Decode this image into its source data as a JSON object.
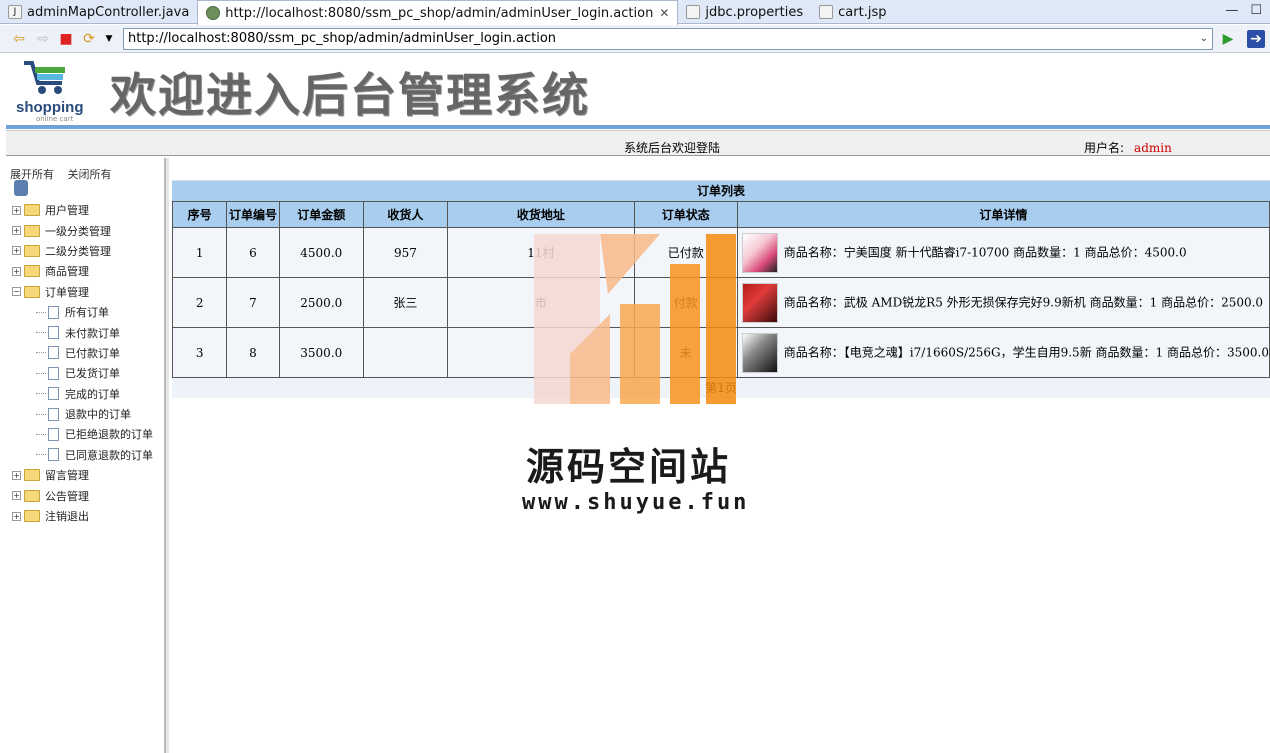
{
  "tabs": [
    {
      "label": "adminMapController.java",
      "icon": "java-file-icon"
    },
    {
      "label": "http://localhost:8080/ssm_pc_shop/admin/adminUser_login.action",
      "icon": "globe-icon",
      "active": true
    },
    {
      "label": "jdbc.properties",
      "icon": "properties-file-icon"
    },
    {
      "label": "cart.jsp",
      "icon": "jsp-file-icon"
    }
  ],
  "browser": {
    "url": "http://localhost:8080/ssm_pc_shop/admin/adminUser_login.action"
  },
  "header": {
    "logo_text": "shopping",
    "logo_sub": "online cart",
    "title": "欢迎进入后台管理系统"
  },
  "topbar": {
    "welcome": "系统后台欢迎登陆",
    "user_label": "用户名:",
    "user": "admin"
  },
  "sidebar": {
    "expand_all": "展开所有",
    "collapse_all": "关闭所有",
    "nodes": [
      {
        "label": "用户管理",
        "type": "folder"
      },
      {
        "label": "一级分类管理",
        "type": "folder"
      },
      {
        "label": "二级分类管理",
        "type": "folder"
      },
      {
        "label": "商品管理",
        "type": "folder"
      },
      {
        "label": "订单管理",
        "type": "folder-open"
      },
      {
        "label": "所有订单",
        "type": "page"
      },
      {
        "label": "未付款订单",
        "type": "page"
      },
      {
        "label": "已付款订单",
        "type": "page"
      },
      {
        "label": "已发货订单",
        "type": "page"
      },
      {
        "label": "完成的订单",
        "type": "page"
      },
      {
        "label": "退款中的订单",
        "type": "page"
      },
      {
        "label": "已拒绝退款的订单",
        "type": "page"
      },
      {
        "label": "已同意退款的订单",
        "type": "page"
      },
      {
        "label": "留言管理",
        "type": "folder"
      },
      {
        "label": "公告管理",
        "type": "folder"
      },
      {
        "label": "注销退出",
        "type": "folder"
      }
    ]
  },
  "orders": {
    "title": "订单列表",
    "columns": [
      "序号",
      "订单编号",
      "订单金额",
      "收货人",
      "收货地址",
      "订单状态",
      "订单详情"
    ],
    "rows": [
      {
        "seq": "1",
        "id": "6",
        "amount": "4500.0",
        "receiver": "957",
        "address": "11村",
        "status": "已付款",
        "detail": "商品名称：宁美国度 新十代酷睿i7-10700",
        "qty": "商品数量：1",
        "total": "商品总价：4500.0"
      },
      {
        "seq": "2",
        "id": "7",
        "amount": "2500.0",
        "receiver": "张三",
        "address": "市",
        "status": "付款",
        "detail": "商品名称：武极 AMD锐龙R5 外形无损保存完好9.9新机",
        "qty": "商品数量：1",
        "total": "商品总价：2500.0"
      },
      {
        "seq": "3",
        "id": "8",
        "amount": "3500.0",
        "receiver": "",
        "address": "",
        "status": "未",
        "detail": "商品名称：【电竞之魂】i7/1660S/256G，学生自用9.5新",
        "qty": "商品数量：1",
        "total": "商品总价：3500.0"
      }
    ],
    "pager": "第1页"
  },
  "watermark": {
    "title": "源码空间站",
    "url": "www.shuyue.fun"
  }
}
